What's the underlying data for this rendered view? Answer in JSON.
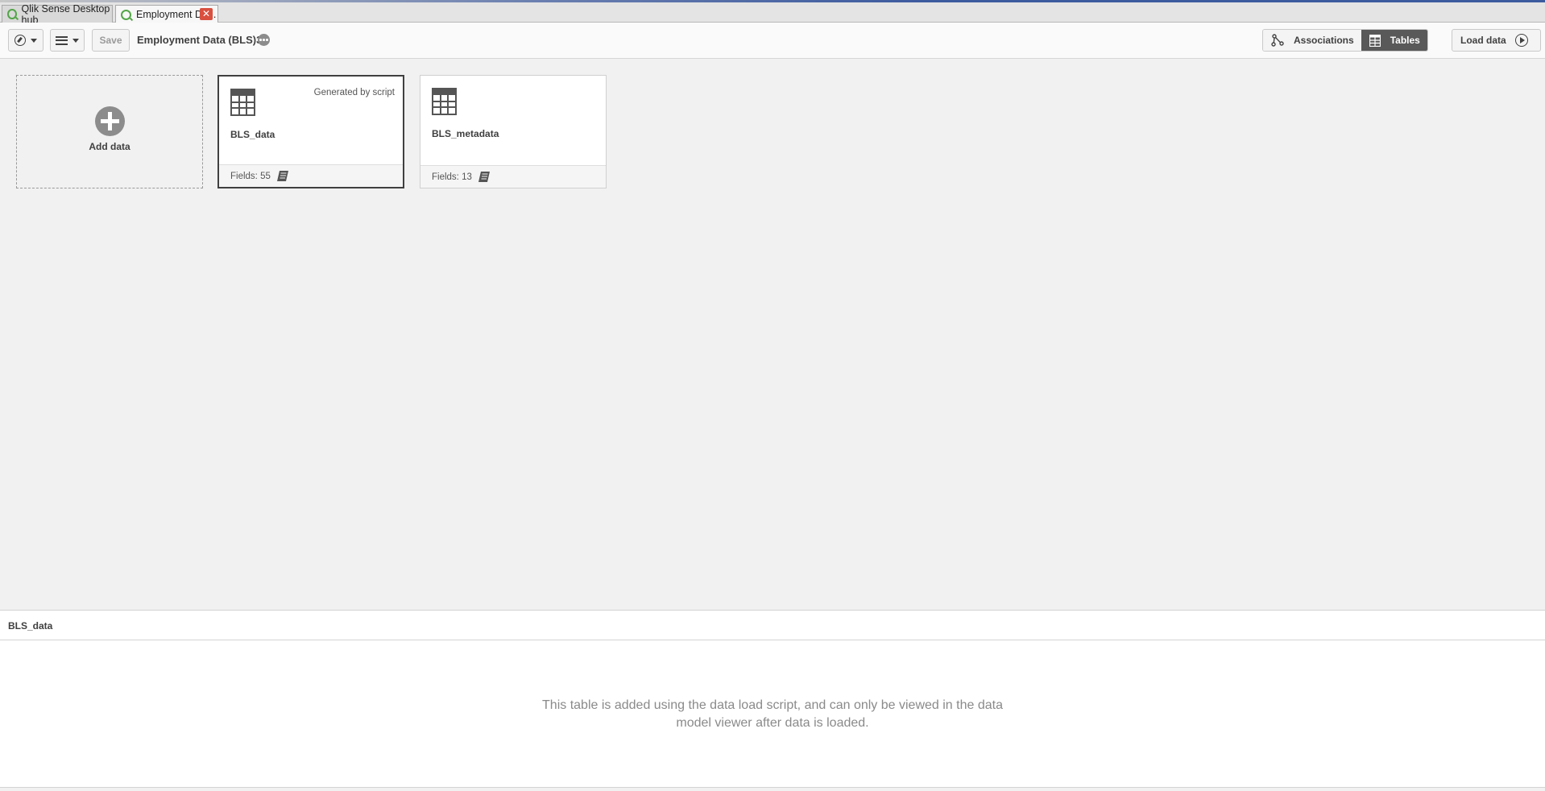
{
  "tabs": [
    {
      "label": "Qlik Sense Desktop hub",
      "active": false
    },
    {
      "label": "Employment Da...",
      "active": true,
      "close_label": "✕"
    }
  ],
  "toolbar": {
    "save_label": "Save",
    "app_title": "Employment Data (BLS)3",
    "view_toggle": {
      "associations_label": "Associations",
      "tables_label": "Tables",
      "selected": "Tables"
    },
    "load_data_label": "Load data"
  },
  "canvas": {
    "add_data_label": "Add data",
    "tables": [
      {
        "name": "BLS_data",
        "fields_label": "Fields: 55",
        "badge": "Generated by script",
        "selected": true
      },
      {
        "name": "BLS_metadata",
        "fields_label": "Fields: 13",
        "badge": "",
        "selected": false
      }
    ]
  },
  "bottom_panel": {
    "title": "BLS_data",
    "message_line1": "This table is added using the data load script, and can only be viewed in the data",
    "message_line2": "model viewer after data is loaded."
  },
  "colors": {
    "accent_dark": "#595959",
    "close_red": "#d9503f",
    "qlik_green": "#53a548",
    "background": "#f1f1f1"
  },
  "icons": [
    "navigation-compass-icon",
    "list-icon",
    "more-options-icon",
    "associations-icon",
    "tables-icon",
    "play-icon",
    "add-icon",
    "table-icon",
    "script-icon",
    "qlik-logo-icon"
  ]
}
